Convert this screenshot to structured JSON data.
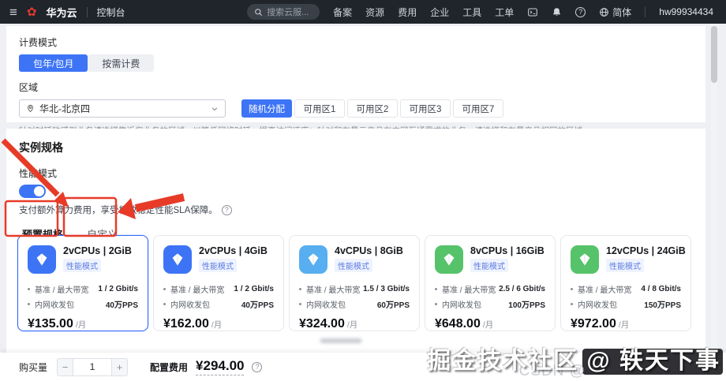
{
  "topnav": {
    "brand": "华为云",
    "console_label": "控制台",
    "search_placeholder": "搜索云服...",
    "menu_items": [
      "备案",
      "资源",
      "费用",
      "企业",
      "工具",
      "工单"
    ],
    "locale_label": "简体",
    "account_id": "hw99934434"
  },
  "icons": {
    "hamburger": "≡",
    "logo_flower": "✿",
    "help": "?"
  },
  "billing_section": {
    "billing_label": "计费模式",
    "billing_options": [
      {
        "label": "包年/包月",
        "selected": true
      },
      {
        "label": "按需计费",
        "selected": false
      }
    ],
    "region_label": "区域",
    "region_value": "华北-北京四",
    "az_options": [
      {
        "label": "随机分配",
        "selected": true
      },
      {
        "label": "可用区1",
        "selected": false
      },
      {
        "label": "可用区2",
        "selected": false
      },
      {
        "label": "可用区3",
        "selected": false
      },
      {
        "label": "可用区7",
        "selected": false
      }
    ],
    "region_hint": "针对时延敏感型业务请选择靠近您业务的区域，以降低网络时延，提高访问速度；针对和存量云产品有内网互通需求的业务，请选择和存量产品相同的区域。"
  },
  "spec_section": {
    "title": "实例规格",
    "perf_mode_label": "性能模式",
    "perf_toggle_state": "on",
    "sla_note": "支付额外算力费用，享受极致稳定性能SLA保障。",
    "tabs": [
      {
        "label": "预置规格",
        "selected": true
      },
      {
        "label": "自定义",
        "selected": false
      }
    ],
    "cards": [
      {
        "title": "2vCPUs | 2GiB",
        "badge": "性能模式",
        "icon_color": "#3d74f6",
        "selected": true,
        "rows": [
          {
            "label": "基准 / 最大带宽",
            "value": "1 / 2 Gbit/s"
          },
          {
            "label": "内网收发包",
            "value": "40万PPS"
          }
        ],
        "price": "¥135.00",
        "unit": "/月"
      },
      {
        "title": "2vCPUs | 4GiB",
        "badge": "性能模式",
        "icon_color": "#3d74f6",
        "selected": false,
        "rows": [
          {
            "label": "基准 / 最大带宽",
            "value": "1 / 2 Gbit/s"
          },
          {
            "label": "内网收发包",
            "value": "40万PPS"
          }
        ],
        "price": "¥162.00",
        "unit": "/月"
      },
      {
        "title": "4vCPUs | 8GiB",
        "badge": "性能模式",
        "icon_color": "#57aef0",
        "selected": false,
        "rows": [
          {
            "label": "基准 / 最大带宽",
            "value": "1.5 / 3 Gbit/s"
          },
          {
            "label": "内网收发包",
            "value": "60万PPS"
          }
        ],
        "price": "¥324.00",
        "unit": "/月"
      },
      {
        "title": "8vCPUs | 16GiB",
        "badge": "性能模式",
        "icon_color": "#56c36a",
        "selected": false,
        "rows": [
          {
            "label": "基准 / 最大带宽",
            "value": "2.5 / 6 Gbit/s"
          },
          {
            "label": "内网收发包",
            "value": "100万PPS"
          }
        ],
        "price": "¥648.00",
        "unit": "/月"
      },
      {
        "title": "12vCPUs | 24GiB",
        "badge": "性能模式",
        "icon_color": "#56c36a",
        "selected": false,
        "rows": [
          {
            "label": "基准 / 最大带宽",
            "value": "4 / 8 Gbit/s"
          },
          {
            "label": "内网收发包",
            "value": "150万PPS"
          }
        ],
        "price": "¥972.00",
        "unit": "/月"
      }
    ]
  },
  "footer_bar": {
    "quantity_label": "购买量",
    "quantity_value": "1",
    "minus_label": "−",
    "plus_label": "+",
    "cost_label": "配置费用",
    "cost_value": "¥294.00"
  },
  "watermark": {
    "primary": "掘金技术社区 @ 轶天下事",
    "secondary": "CSDN @"
  },
  "colors": {
    "primary_blue": "#3d74f6",
    "annotation_red": "#e73b28",
    "nav_bg": "#20242b",
    "green_icon": "#56c36a",
    "light_blue_icon": "#57aef0"
  }
}
